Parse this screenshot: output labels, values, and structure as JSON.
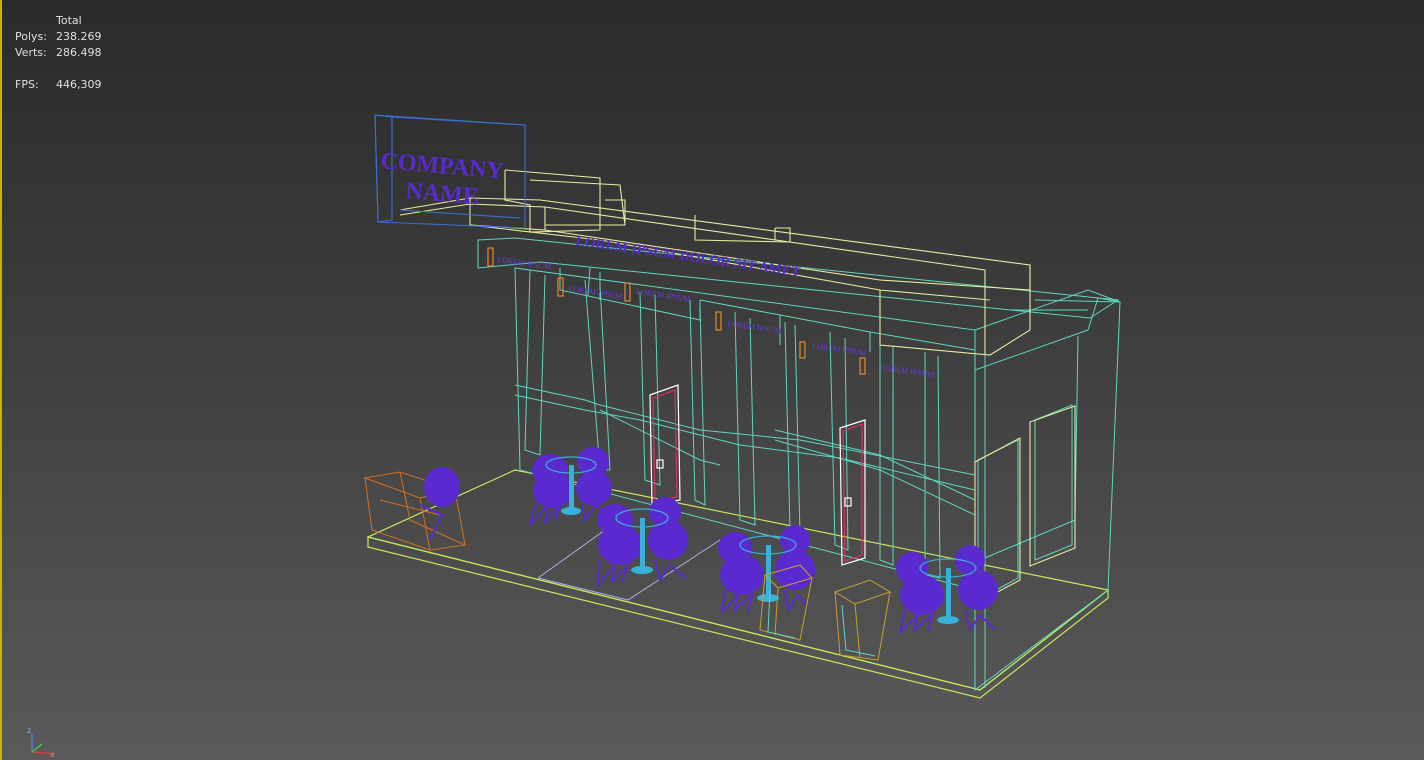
{
  "viewport": {
    "stats": {
      "header": "Total",
      "polys_label": "Polys:",
      "polys_value": "238.269",
      "verts_label": "Verts:",
      "verts_value": "286.498",
      "fps_label": "FPS:",
      "fps_value": "446,309"
    },
    "scene": {
      "sign_text_line1": "COMPANY",
      "sign_text_line2": "NAME",
      "banner_text": "LOREM IPSUM DOLOR SIT AMET",
      "small_labels": [
        "LOREM IPSUM",
        "LOREM IPSUM",
        "LOREM IPSUM",
        "LOREM IPSUM",
        "LOREM IPSUM",
        "LOREM IPSUM"
      ]
    },
    "gizmo": {
      "z_label": "z",
      "x_label": "x"
    }
  },
  "colors": {
    "wire_cyan": "#5fd6c0",
    "wire_yellow": "#e8eba0",
    "wire_lime": "#c7e85a",
    "wire_blue": "#3a6fd0",
    "wire_orange": "#e08a2a",
    "furniture_purple": "#5a2ad0",
    "table_cyan": "#3ab0d8",
    "door_red": "#d83060",
    "active_border": "#c8b400",
    "stats_text": "#e0e0e0"
  }
}
